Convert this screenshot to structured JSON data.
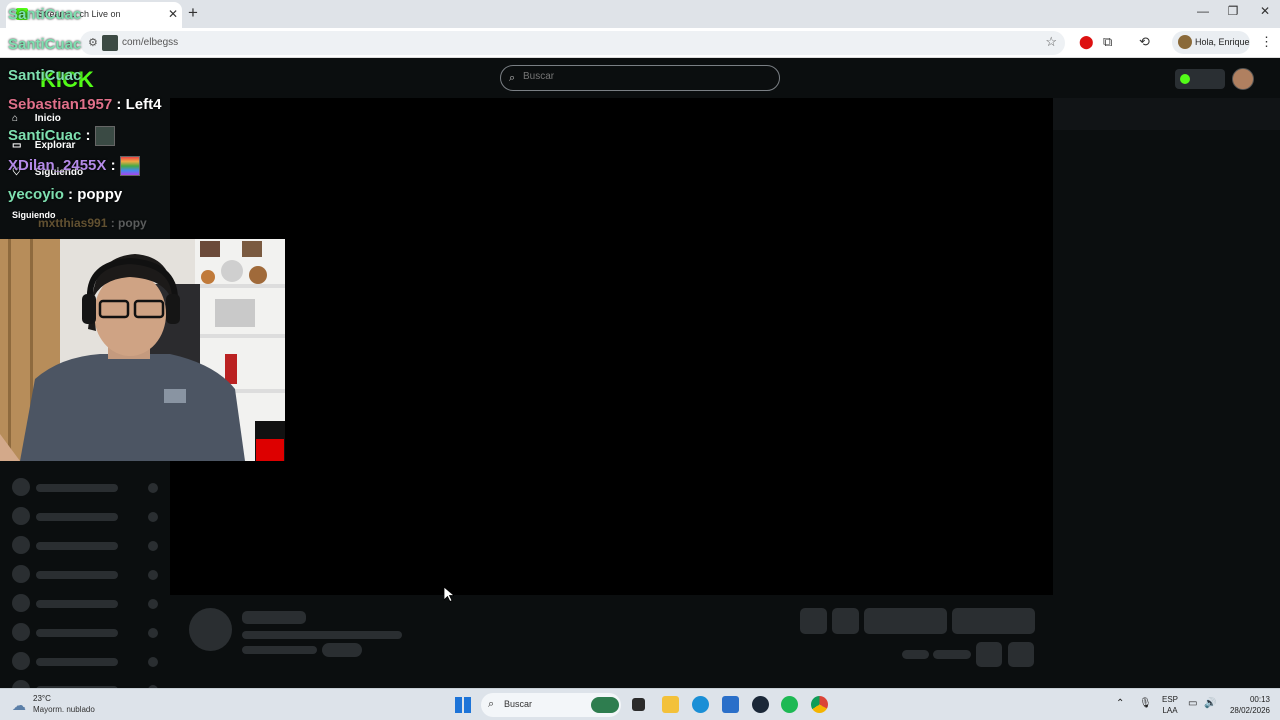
{
  "browser": {
    "tab_title": "Stream ... ch Live on",
    "url": "com/elbegss",
    "profile_greeting": "Hola, Enrique"
  },
  "site": {
    "logo": "KICK",
    "search_placeholder": "Buscar",
    "accent_color": "#53fc18"
  },
  "sidebar": {
    "items": [
      {
        "label": "Inicio",
        "icon": "home-icon"
      },
      {
        "label": "Explorar",
        "icon": "compass-icon"
      },
      {
        "label": "Siguiendo",
        "icon": "heart-icon"
      }
    ],
    "section_heading": "Siguiendo"
  },
  "chat_overlay": [
    {
      "user": "SantiCuac",
      "message": "",
      "color": "#7ee0b0"
    },
    {
      "user": "SantiCuac",
      "message": "",
      "color": "#7ee0b0"
    },
    {
      "user": "SantiCuac",
      "message": "",
      "color": "#7ee0b0"
    },
    {
      "user": "Sebastian1957",
      "message": "Left4",
      "color": "#e0708a"
    },
    {
      "user": "SantiCuac",
      "message": "",
      "color": "#7ee0b0"
    },
    {
      "user": "XDilan_2455X",
      "message": "",
      "color": "#b48ae8"
    },
    {
      "user": "yecoyio",
      "message": "poppy",
      "color": "#7ee0b0"
    },
    {
      "user": "mxtthias991",
      "message": "popy",
      "color": "#c9a05a"
    }
  ],
  "taskbar": {
    "weather_temp": "23°C",
    "weather_desc": "Mayorm. nublado",
    "search_label": "Buscar",
    "lang_1": "ESP",
    "lang_2": "LAA",
    "time": "00:13",
    "date": "28/02/2026"
  }
}
